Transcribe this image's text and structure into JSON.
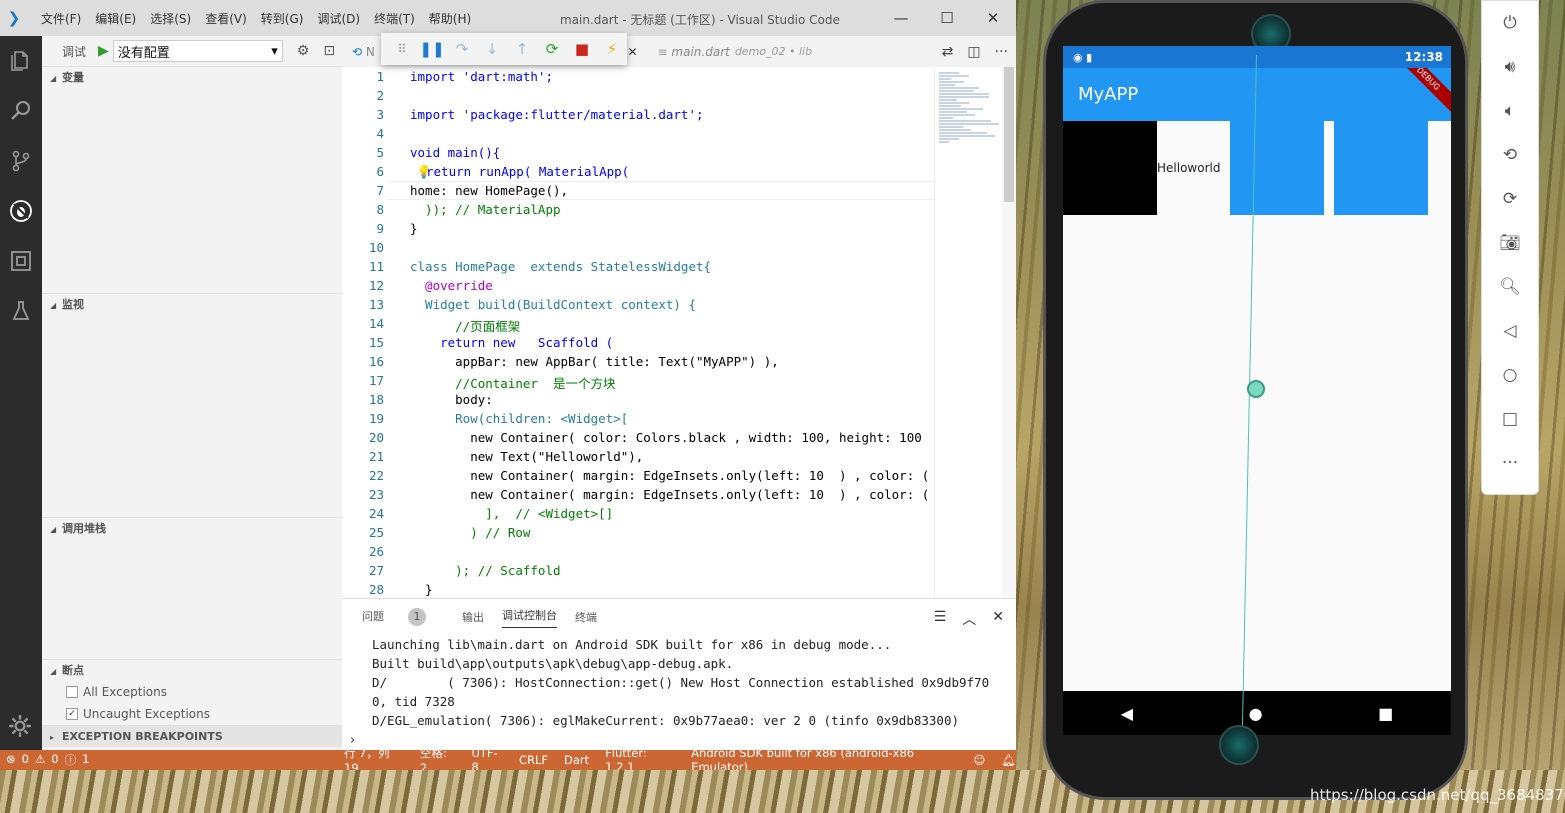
{
  "titlebar": {
    "menu": [
      "文件(F)",
      "编辑(E)",
      "选择(S)",
      "查看(V)",
      "转到(G)",
      "调试(D)",
      "终端(T)",
      "帮助(H)"
    ],
    "title": "main.dart - 无标题 (工作区) - Visual Studio Code"
  },
  "sidebar": {
    "debug_label": "调试",
    "config": "没有配置",
    "sections": {
      "variables": "变量",
      "watch": "监视",
      "callstack": "调用堆栈",
      "breakpoints": "断点"
    },
    "bp_items": [
      {
        "label": "All Exceptions",
        "checked": false
      },
      {
        "label": "Uncaught Exceptions",
        "checked": true
      }
    ],
    "exception_bps": "EXCEPTION BREAKPOINTS"
  },
  "tabs": [
    {
      "label": "N",
      "active": false
    },
    {
      "label": "ib",
      "active": true
    },
    {
      "label": "main.dart",
      "desc": "demo_02 • lib",
      "active": false
    }
  ],
  "code_lines": [
    "1",
    "2",
    "3",
    "4",
    "5",
    "6",
    "7",
    "8",
    "9",
    "10",
    "11",
    "12",
    "13",
    "14",
    "15",
    "16",
    "17",
    "18",
    "19",
    "20",
    "21",
    "22",
    "23",
    "24",
    "25",
    "26",
    "27",
    "28"
  ],
  "code": {
    "l1": "import 'dart:math';",
    "l3": "import 'package:flutter/material.dart';",
    "l5": "void main(){",
    "l6": "return runApp( MaterialApp(",
    "l7": "home: new HomePage(),",
    "l8": "  )); // MaterialApp",
    "l9": "}",
    "l11": "class HomePage  extends StatelessWidget{",
    "l12": "  @override",
    "l13": "  Widget build(BuildContext context) {",
    "l14": "      //页面框架",
    "l15": "    return new   Scaffold (",
    "l16": "      appBar: new AppBar( title: Text(\"MyAPP\") ),",
    "l17": "      //Container  是一个方块",
    "l18": "      body:",
    "l19": "      Row(children: <Widget>[",
    "l20": "        new Container( color: Colors.black , width: 100, height: 100",
    "l21": "        new Text(\"Helloworld\"),",
    "l22": "        new Container( margin: EdgeInsets.only(left: 10  ) , color: (",
    "l23": "        new Container( margin: EdgeInsets.only(left: 10  ) , color: (",
    "l24": "          ],  // <Widget>[]",
    "l25": "        ) // Row",
    "l27": "      ); // Scaffold",
    "l28": "  }"
  },
  "panel": {
    "tabs": [
      "问题",
      "输出",
      "调试控制台",
      "终端"
    ],
    "problem_count": "1",
    "output": [
      "Launching lib\\main.dart on Android SDK built for x86 in debug mode...",
      "Built build\\app\\outputs\\apk\\debug\\app-debug.apk.",
      "D/        ( 7306): HostConnection::get() New Host Connection established 0x9db9f70",
      "0, tid 7328",
      "D/EGL_emulation( 7306): eglMakeCurrent: 0x9b77aea0: ver 2 0 (tinfo 0x9db83300)"
    ],
    "prompt": "›"
  },
  "status": {
    "errors": "0",
    "warnings": "0",
    "infos": "1",
    "items": [
      "行 7，列 19",
      "空格: 2",
      "UTF-8",
      "CRLF",
      "Dart",
      "Flutter: 1.2.1",
      "Android SDK built for x86 (android-x86 Emulator)"
    ]
  },
  "phone": {
    "time": "12:38",
    "app_title": "MyAPP",
    "hello": "Helloworld",
    "ribbon": "DEBUG"
  },
  "watermark": "https://blog.csdn.net/qq_36848370"
}
